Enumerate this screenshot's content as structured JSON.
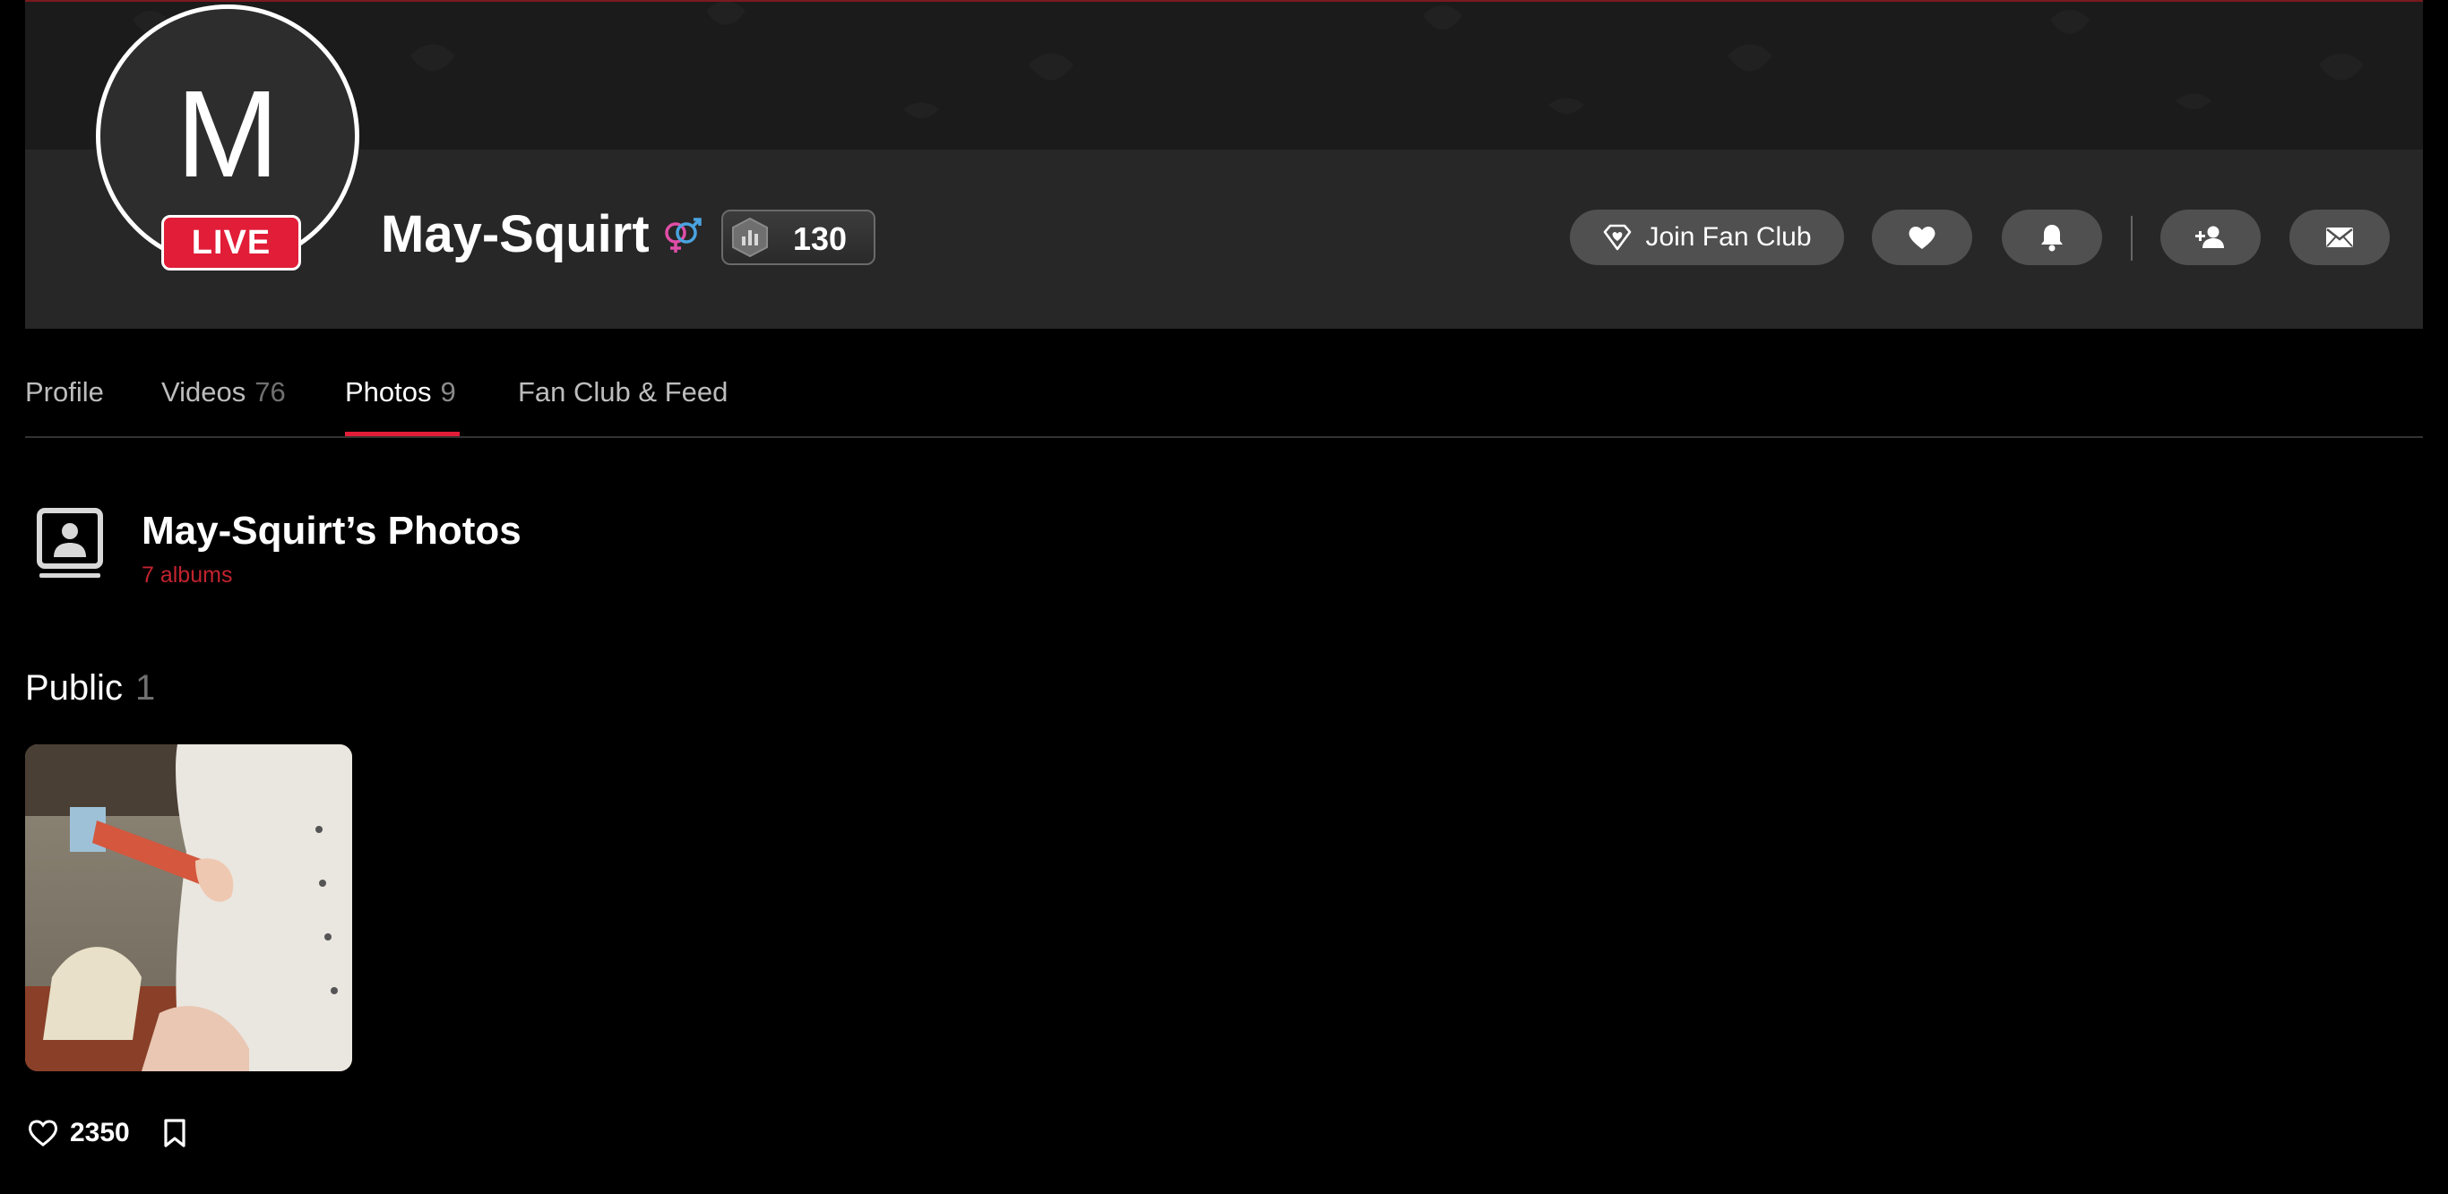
{
  "profile": {
    "avatar_letter": "M",
    "live_label": "LIVE",
    "username": "May-Squirt",
    "level": "130"
  },
  "actions": {
    "join_fan_club": "Join Fan Club"
  },
  "tabs": [
    {
      "label": "Profile",
      "count": ""
    },
    {
      "label": "Videos",
      "count": "76"
    },
    {
      "label": "Photos",
      "count": "9"
    },
    {
      "label": "Fan Club & Feed",
      "count": ""
    }
  ],
  "section": {
    "title": "May-Squirt’s Photos",
    "subtitle": "7 albums"
  },
  "album": {
    "title": "Public",
    "count": "1",
    "likes": "2350"
  },
  "colors": {
    "accent": "#e11d38",
    "button_bg": "#505050",
    "cover_bg": "#272727"
  },
  "icons": [
    "diamond-heart-icon",
    "heart-icon",
    "bell-icon",
    "add-friend-icon",
    "envelope-icon",
    "gender-icon",
    "level-badge-icon",
    "photo-album-icon",
    "bookmark-icon"
  ]
}
